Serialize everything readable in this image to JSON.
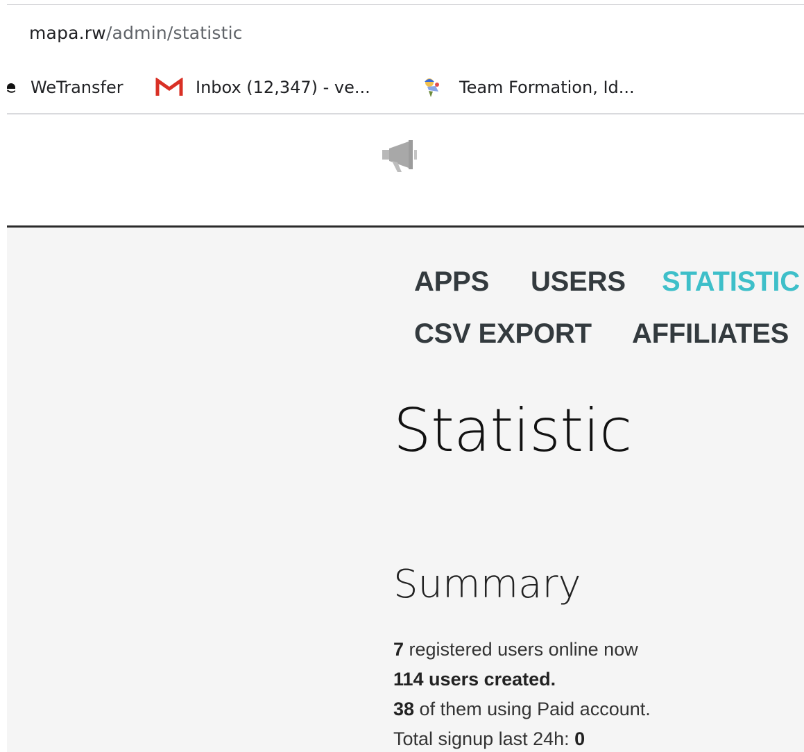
{
  "browser": {
    "url_host": "mapa.rw",
    "url_path": "/admin/statistic",
    "bookmarks": [
      {
        "label": "WeTransfer",
        "icon": "partial-favicon-icon"
      },
      {
        "label": "Inbox (12,347) - ve...",
        "icon": "gmail-icon"
      },
      {
        "label": "Team Formation, Id...",
        "icon": "team-formation-icon"
      }
    ]
  },
  "banner": {
    "icon": "megaphone-icon"
  },
  "nav": {
    "items": [
      {
        "label": "APPS",
        "active": false
      },
      {
        "label": "USERS",
        "active": false
      },
      {
        "label": "STATISTIC",
        "active": true
      },
      {
        "label": "CSV EXPORT",
        "active": false
      },
      {
        "label": "AFFILIATES",
        "active": false
      }
    ]
  },
  "page": {
    "title": "Statistic",
    "summary_heading": "Summary"
  },
  "summary": {
    "online_count": "7",
    "online_text": " registered users online now",
    "created_text": "114 users created.",
    "paid_count": "38",
    "paid_text": " of them using Paid account.",
    "signup_label": "Total signup last 24h: ",
    "signup_count": "0"
  },
  "colors": {
    "accent": "#3ebfc9",
    "nav_text": "#333a3e",
    "content_bg": "#f5f5f5",
    "gmail_red": "#d93025"
  }
}
